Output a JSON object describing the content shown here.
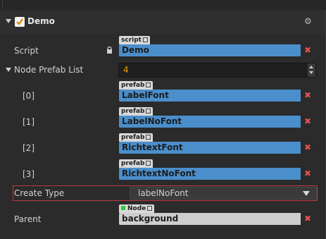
{
  "component": {
    "title": "Demo",
    "enabled": true,
    "icons": {
      "collapse": "triangle-down-icon",
      "settings": "gear-icon"
    }
  },
  "script": {
    "label": "Script",
    "tag": "script",
    "value": "Demo",
    "locked": true
  },
  "node_prefab_list": {
    "label": "Node Prefab List",
    "count": "4",
    "items": [
      {
        "index_label": "[0]",
        "tag": "prefab",
        "value": "LabelFont"
      },
      {
        "index_label": "[1]",
        "tag": "prefab",
        "value": "LabelNoFont"
      },
      {
        "index_label": "[2]",
        "tag": "prefab",
        "value": "RichtextFont"
      },
      {
        "index_label": "[3]",
        "tag": "prefab",
        "value": "RichtextNoFont"
      }
    ]
  },
  "create_type": {
    "label": "Create Type",
    "selected": "labelNoFont"
  },
  "parent": {
    "label": "Parent",
    "tag": "Node",
    "value": "background"
  },
  "colors": {
    "background": "#2b2b2b",
    "asset_field": "#4a8fcb",
    "node_field": "#cdcdcd",
    "count_value": "#f0a000",
    "clear_x": "#d9534f",
    "highlight_border": "#c0393b",
    "checkbox_accent": "#e08a10"
  },
  "clear_symbol": "✖"
}
